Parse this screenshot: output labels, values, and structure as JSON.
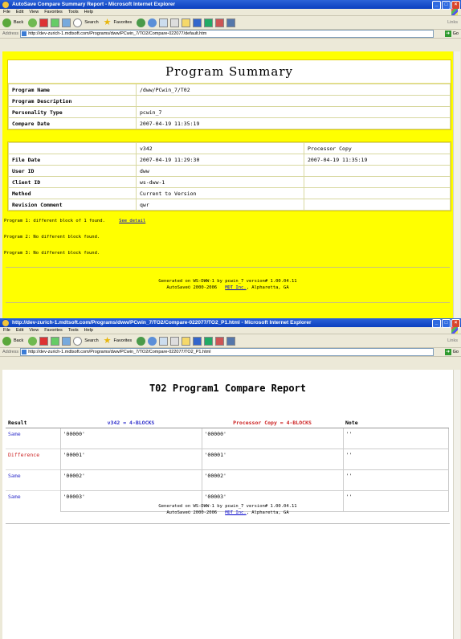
{
  "win1": {
    "title": "AutoSave Compare Summary Report - Microsoft Internet Explorer",
    "menu": [
      "File",
      "Edit",
      "View",
      "Favorites",
      "Tools",
      "Help"
    ],
    "toolbar": {
      "back": "Back",
      "search": "Search",
      "favorites": "Favorites",
      "links": "Links"
    },
    "address": {
      "label": "Address",
      "url": "http://dev-zurich-1.mdtsoft.com/Programs/dww/PCwin_7/TO2/Compare-022077/default.htm",
      "go": "Go"
    },
    "summary_title": "Program Summary",
    "program_rows": [
      {
        "label": "Program Name",
        "value": "/dww/PCwin_7/T02"
      },
      {
        "label": "Program Description",
        "value": ""
      },
      {
        "label": "Personality Type",
        "value": "pcwin_7"
      },
      {
        "label": "Compare Date",
        "value": "2007-04-19 11:35:19"
      }
    ],
    "compare_header": {
      "version": "v342",
      "copy": "Processor Copy"
    },
    "compare_rows": [
      {
        "label": "File Date",
        "version": "2007-04-19 11:29:30",
        "copy": "2007-04-19 11:35:19"
      },
      {
        "label": "User ID",
        "version": "dww",
        "copy": ""
      },
      {
        "label": "Client ID",
        "version": "ws-dww-1",
        "copy": ""
      },
      {
        "label": "Method",
        "version": "Current to Version",
        "copy": ""
      },
      {
        "label": "Revision Comment",
        "version": "qwr",
        "copy": ""
      }
    ],
    "program_results": [
      {
        "text": "Program 1: different block of 1 found.",
        "link": "See detail"
      },
      {
        "text": "Program 2: No different block found.",
        "link": ""
      },
      {
        "text": "Program 3: No different block found.",
        "link": ""
      }
    ],
    "footer": {
      "line1": "Generated on WS-DWW-1 by pcwin_7 version# 1.00.04.11",
      "line2_prefix": "AutoSave© 2000-2006",
      "company": "MDT Inc.",
      "line2_suffix": ", Alpharetta, GA"
    }
  },
  "win2": {
    "title": "http://dev-zurich-1.mdtsoft.com/Programs/dww/PCwin_7/TO2/Compare-022077/TO2_P1.html - Microsoft Internet Explorer",
    "menu": [
      "File",
      "Edit",
      "View",
      "Favorites",
      "Tools",
      "Help"
    ],
    "toolbar": {
      "back": "Back",
      "search": "Search",
      "favorites": "Favorites",
      "links": "Links"
    },
    "address": {
      "label": "Address",
      "url": "http://dev-zurich-1.mdtsoft.com/Programs/dww/PCwin_7/TO2/Compare-022077/TO2_P1.html",
      "go": "Go"
    },
    "report_title": "T02 Program1 Compare Report",
    "table_headers": {
      "result": "Result",
      "version": "v342 = 4-BLOCKS",
      "copy": "Processor Copy = 4-BLOCKS",
      "note": "Note"
    },
    "rows": [
      {
        "result": "Same",
        "version": "'00000'",
        "copy": "'00000'",
        "note": "''"
      },
      {
        "result": "Difference",
        "version": "'00001'",
        "copy": "'00001'",
        "note": "''"
      },
      {
        "result": "Same",
        "version": "'00002'",
        "copy": "'00002'",
        "note": "''"
      },
      {
        "result": "Same",
        "version": "'00003'",
        "copy": "'00003'",
        "note": "''"
      }
    ],
    "footer": {
      "line1": "Generated on WS-DWW-1 by pcwin_7 version# 1.00.04.11",
      "line2_prefix": "AutoSave© 2000-2006",
      "company": "MDT Inc.",
      "line2_suffix": ", Alpharetta, GA"
    }
  }
}
